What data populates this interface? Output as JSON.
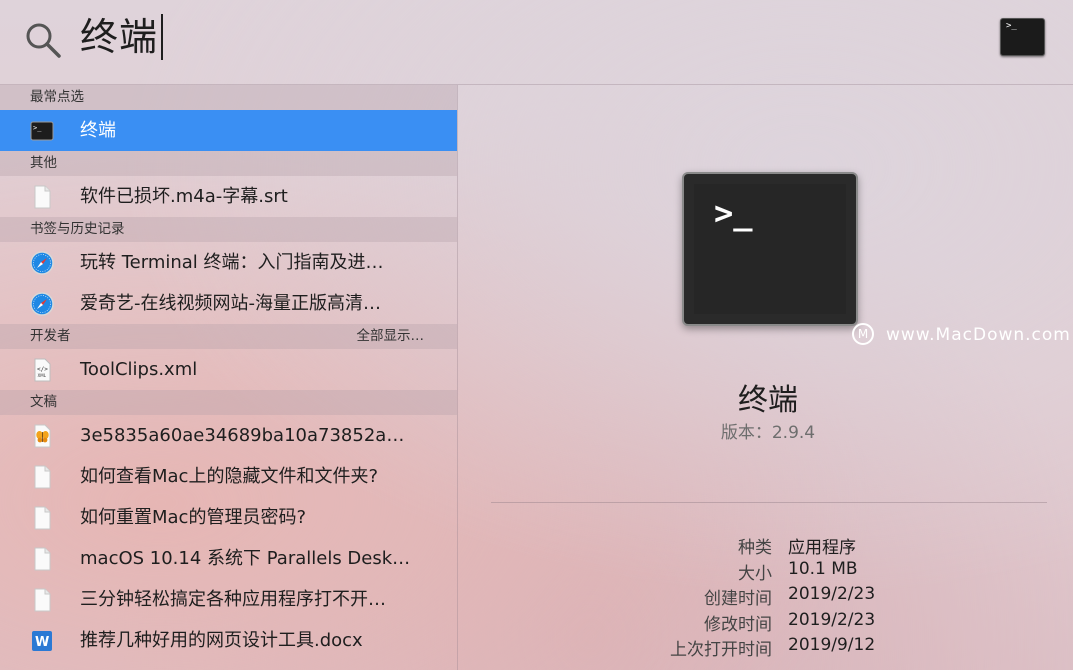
{
  "search": {
    "query": "终端",
    "icon": "search-icon"
  },
  "badge_icon": "terminal-icon",
  "badge_prompt": ">_",
  "sections": [
    {
      "title": "最常点选",
      "more": "",
      "items": [
        {
          "label": "终端",
          "icon": "terminal-icon",
          "selected": true
        }
      ]
    },
    {
      "title": "其他",
      "more": "",
      "items": [
        {
          "label": "软件已损坏.m4a-字幕.srt",
          "icon": "document-icon",
          "selected": false
        }
      ]
    },
    {
      "title": "书签与历史记录",
      "more": "",
      "items": [
        {
          "label": "玩转 Terminal 终端：入门指南及进…",
          "icon": "safari-icon",
          "selected": false
        },
        {
          "label": "爱奇艺-在线视频网站-海量正版高清…",
          "icon": "safari-icon",
          "selected": false
        }
      ]
    },
    {
      "title": "开发者",
      "more": "全部显示…",
      "items": [
        {
          "label": "ToolClips.xml",
          "icon": "xml-file-icon",
          "selected": false
        }
      ]
    },
    {
      "title": "文稿",
      "more": "",
      "items": [
        {
          "label": "3e5835a60ae34689ba10a73852a…",
          "icon": "butterfly-file-icon",
          "selected": false
        },
        {
          "label": "如何查看Mac上的隐藏文件和文件夹?",
          "icon": "document-icon",
          "selected": false
        },
        {
          "label": "如何重置Mac的管理员密码?",
          "icon": "document-icon",
          "selected": false
        },
        {
          "label": "macOS 10.14 系统下 Parallels Desk…",
          "icon": "document-icon",
          "selected": false
        },
        {
          "label": "三分钟轻松搞定各种应用程序打不开…",
          "icon": "document-icon",
          "selected": false
        },
        {
          "label": "推荐几种好用的网页设计工具.docx",
          "icon": "word-icon",
          "selected": false
        }
      ]
    }
  ],
  "preview": {
    "icon": "terminal-icon",
    "prompt": ">_",
    "name": "终端",
    "version": "版本：2.9.4",
    "watermark_logo": "M",
    "watermark": "www.MacDown.com",
    "meta": [
      {
        "key": "种类",
        "value": "应用程序"
      },
      {
        "key": "大小",
        "value": "10.1 MB"
      },
      {
        "key": "创建时间",
        "value": "2019/2/23"
      },
      {
        "key": "修改时间",
        "value": "2019/2/23"
      },
      {
        "key": "上次打开时间",
        "value": "2019/9/12"
      }
    ]
  },
  "colors": {
    "selection": "#3a8ff3",
    "section_header_bg": "#cdbbc4"
  }
}
